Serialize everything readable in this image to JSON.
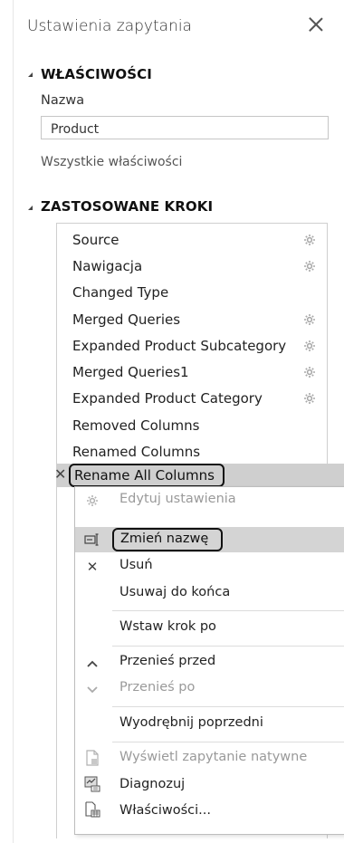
{
  "panel": {
    "title": "Ustawienia zapytania"
  },
  "properties": {
    "heading": "WŁAŚCIWOŚCI",
    "name_label": "Nazwa",
    "name_value": "Product",
    "all_properties_link": "Wszystkie właściwości"
  },
  "steps": {
    "heading": "ZASTOSOWANE KROKI",
    "items": [
      {
        "label": "Source",
        "has_gear": true
      },
      {
        "label": "Nawigacja",
        "has_gear": true
      },
      {
        "label": "Changed Type",
        "has_gear": false
      },
      {
        "label": "Merged Queries",
        "has_gear": true
      },
      {
        "label": "Expanded Product Subcategory",
        "has_gear": true
      },
      {
        "label": "Merged Queries1",
        "has_gear": true
      },
      {
        "label": "Expanded Product Category",
        "has_gear": true
      },
      {
        "label": "Removed Columns",
        "has_gear": false
      },
      {
        "label": "Renamed Columns",
        "has_gear": false
      },
      {
        "label": "Rename All Columns",
        "has_gear": false,
        "selected": true
      }
    ]
  },
  "context_menu": {
    "items": [
      {
        "label": "Edytuj ustawienia",
        "icon": "gear-icon",
        "disabled": true
      },
      {
        "label": "Zmień nazwę",
        "icon": "rename-icon",
        "disabled": false,
        "highlighted": true
      },
      {
        "label": "Usuń",
        "icon": "delete-icon",
        "disabled": false
      },
      {
        "label": "Usuwaj do końca",
        "icon": "",
        "disabled": false
      },
      {
        "label": "Wstaw krok po",
        "icon": "",
        "disabled": false
      },
      {
        "label": "Przenieś przed",
        "icon": "chevron-up-icon",
        "disabled": false
      },
      {
        "label": "Przenieś po",
        "icon": "chevron-down-icon",
        "disabled": true
      },
      {
        "label": "Wyodrębnij poprzedni",
        "icon": "",
        "disabled": false
      },
      {
        "label": "Wyświetl zapytanie natywne",
        "icon": "native-query-icon",
        "disabled": true
      },
      {
        "label": "Diagnozuj",
        "icon": "diagnose-icon",
        "disabled": false
      },
      {
        "label": "Właściwości...",
        "icon": "properties-icon",
        "disabled": false
      }
    ]
  }
}
